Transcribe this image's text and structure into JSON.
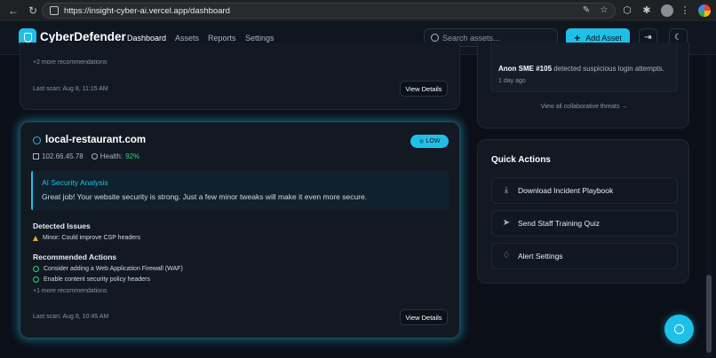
{
  "browser": {
    "url": "https://insight-cyber-ai.vercel.app/dashboard"
  },
  "header": {
    "brand": "CyberDefender",
    "nav": [
      "Dashboard",
      "Assets",
      "Reports",
      "Settings"
    ],
    "active_nav": "Dashboard",
    "search_placeholder": "Search assets...",
    "add_button": "Add Asset"
  },
  "top_card": {
    "more_recommendations": "+2 more recommendations",
    "last_scan": "Last scan: Aug 8, 11:15 AM",
    "view_details": "View Details"
  },
  "asset_card": {
    "domain": "local-restaurant.com",
    "risk_level": "LOW",
    "ip": "102.66.45.78",
    "health_label": "Health:",
    "health_value": "92%",
    "ai_title": "AI Security Analysis",
    "ai_text": "Great job! Your website security is strong. Just a few minor tweaks will make it even more secure.",
    "issues_title": "Detected Issues",
    "issues": [
      "Minor: Could improve CSP headers"
    ],
    "actions_title": "Recommended Actions",
    "actions": [
      "Consider adding a Web Application Firewall (WAF)",
      "Enable content security policy headers"
    ],
    "more_recommendations": "+1 more recommendations",
    "last_scan": "Last scan: Aug 8, 10:45 AM",
    "view_details": "View Details"
  },
  "threats": {
    "item_source": "Anon SME #105",
    "item_text": " detected suspicious login attempts.",
    "item_time": "1 day ago",
    "view_all": "View all collaborative threats →"
  },
  "quick_actions": {
    "title": "Quick Actions",
    "items": [
      "Download Incident Playbook",
      "Send Staff Training Quiz",
      "Alert Settings"
    ]
  },
  "colors": {
    "accent": "#1fc0e8",
    "success": "#2fd07a",
    "warning": "#f5a524",
    "background": "#0b1018"
  }
}
